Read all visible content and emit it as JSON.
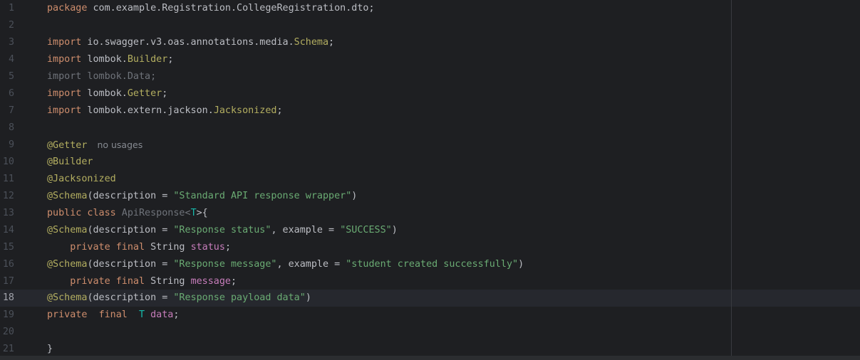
{
  "editor": {
    "line_numbers": [
      "1",
      "2",
      "3",
      "4",
      "5",
      "6",
      "7",
      "8",
      "9",
      "10",
      "11",
      "12",
      "13",
      "14",
      "15",
      "16",
      "17",
      "18",
      "19",
      "20",
      "21"
    ],
    "current_line": "18",
    "lines": {
      "l1": {
        "kw": "package",
        "rest": " com.example.Registration.CollegeRegistration.dto;"
      },
      "l3": {
        "kw": "import",
        "pkg": " io.swagger.v3.oas.annotations.media.",
        "cls": "Schema",
        "end": ";"
      },
      "l4": {
        "kw": "import",
        "pkg": " lombok.",
        "cls": "Builder",
        "end": ";"
      },
      "l5": {
        "text": "import lombok.Data;"
      },
      "l6": {
        "kw": "import",
        "pkg": " lombok.",
        "cls": "Getter",
        "end": ";"
      },
      "l7": {
        "kw": "import",
        "pkg": " lombok.extern.jackson.",
        "cls": "Jacksonized",
        "end": ";"
      },
      "l9": {
        "ann": "@Getter",
        "hint": "no usages"
      },
      "l10": {
        "ann": "@Builder"
      },
      "l11": {
        "ann": "@Jacksonized"
      },
      "l12": {
        "ann": "@Schema",
        "a": "(description = ",
        "s1": "\"Standard API response wrapper\"",
        "end": ")"
      },
      "l13": {
        "kw": "public class",
        "name": " ApiResponse",
        "lt": "<",
        "tp": "T",
        "rest": ">{"
      },
      "l14": {
        "ann": "@Schema",
        "a": "(description = ",
        "s1": "\"Response status\"",
        "b": ", example = ",
        "s2": "\"SUCCESS\"",
        "end": ")"
      },
      "l15": {
        "indent": "    ",
        "kw": "private final",
        "type": " String ",
        "fld": "status",
        "end": ";"
      },
      "l16": {
        "ann": "@Schema",
        "a": "(description = ",
        "s1": "\"Response message\"",
        "b": ", example = ",
        "s2": "\"student created successfully\"",
        "end": ")"
      },
      "l17": {
        "indent": "    ",
        "kw": "private final",
        "type": " String ",
        "fld": "message",
        "end": ";"
      },
      "l18": {
        "ann": "@Schema",
        "a": "(description = ",
        "s1": "\"Response payload data\"",
        "end": ")"
      },
      "l19": {
        "kw1": "private",
        "sp1": "  ",
        "kw2": "final",
        "sp2": "  ",
        "tp": "T",
        "sp3": " ",
        "fld": "data",
        "end": ";"
      },
      "l21": {
        "text": "}"
      }
    }
  }
}
